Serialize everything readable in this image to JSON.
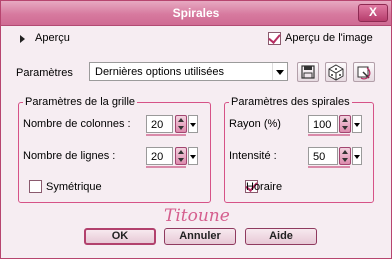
{
  "window": {
    "title": "Spirales",
    "close_glyph": "X"
  },
  "preview": {
    "toggle_label": "Aperçu",
    "image_preview_label": "Aperçu de l'image",
    "image_preview_checked": true
  },
  "presets": {
    "label": "Paramètres",
    "selected": "Dernières options utilisées",
    "icons": [
      "save-preset-icon",
      "random-dice-icon",
      "reset-default-icon"
    ]
  },
  "grid_group": {
    "title": "Paramètres de la grille",
    "columns_label": "Nombre de colonnes :",
    "columns_value": "20",
    "rows_label": "Nombre de lignes :",
    "rows_value": "20",
    "symmetric_label": "Symétrique",
    "symmetric_checked": false
  },
  "spiral_group": {
    "title": "Paramètres des spirales",
    "radius_label": "Rayon (%)",
    "radius_value": "100",
    "intensity_label": "Intensité :",
    "intensity_value": "50",
    "clockwise_label": "Horaire",
    "clockwise_checked": true
  },
  "watermark": "Titoune",
  "buttons": {
    "ok": "OK",
    "cancel": "Annuler",
    "help": "Aide"
  },
  "colors": {
    "accent": "#d65287",
    "title_bar": "#d77a9f",
    "background": "#f6edf2"
  }
}
